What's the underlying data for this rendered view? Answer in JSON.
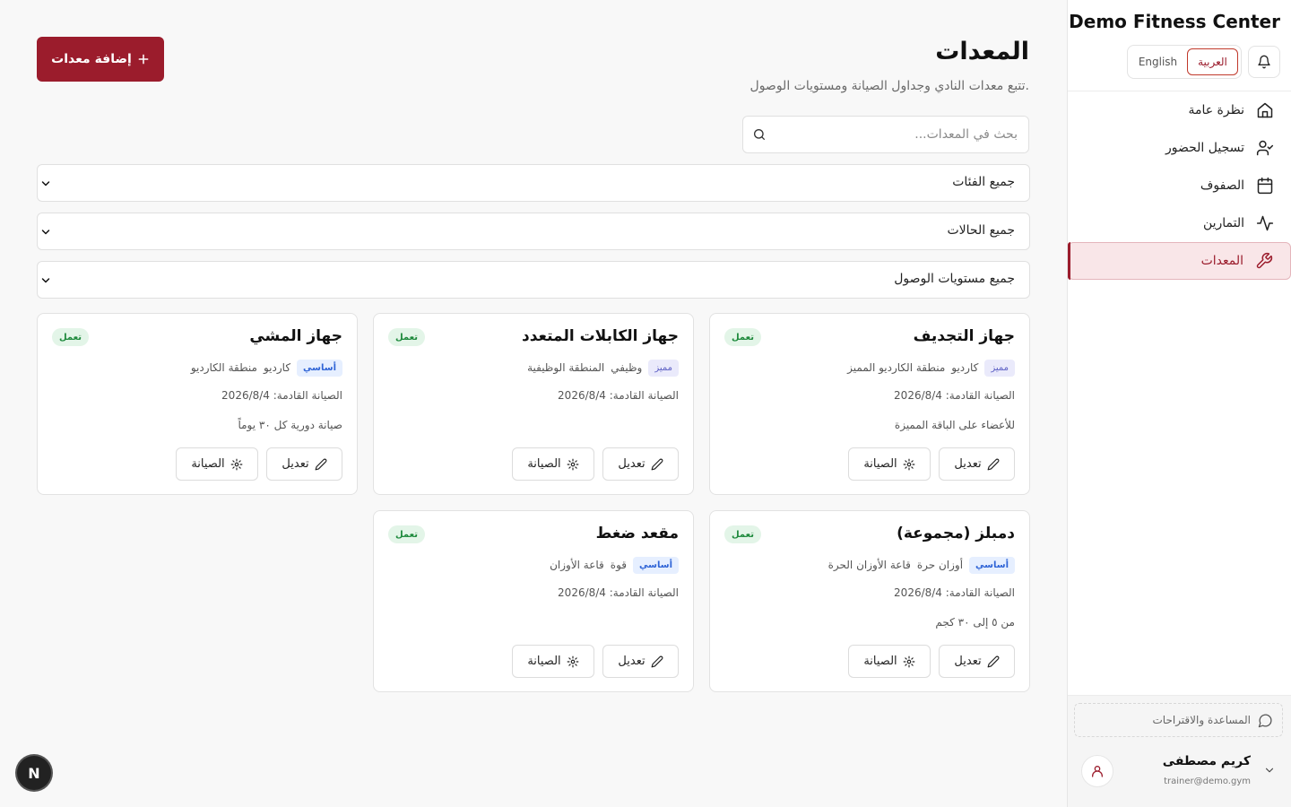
{
  "sidebar": {
    "brand": "Demo Fitness Center",
    "lang": {
      "arabic": "العربية",
      "english": "English"
    },
    "nav": [
      {
        "label": "نظرة عامة",
        "icon": "home-icon"
      },
      {
        "label": "تسجيل الحضور",
        "icon": "user-check-icon"
      },
      {
        "label": "الصفوف",
        "icon": "calendar-icon"
      },
      {
        "label": "التمارين",
        "icon": "activity-icon"
      },
      {
        "label": "المعدات",
        "icon": "wrench-icon",
        "active": true
      }
    ],
    "help": "المساعدة والاقتراحات",
    "user": {
      "name": "كريم مصطفى",
      "email": "trainer@demo.gym"
    }
  },
  "header": {
    "title": "المعدات",
    "subtitle": "تتبع معدات النادي وجداول الصيانة ومستويات الوصول.",
    "add_button": "إضافة معدات"
  },
  "search": {
    "placeholder": "بحث في المعدات..."
  },
  "filters": {
    "category": "جميع الفئات",
    "status": "جميع الحالات",
    "access": "جميع مستويات الوصول"
  },
  "cards": [
    {
      "title": "جهاز التجديف",
      "status": "تعمل",
      "tier": "مميز",
      "category": "كارديو",
      "area": "منطقة الكارديو المميز",
      "maintenance": "الصيانة القادمة: 2026/8/4",
      "note": "للأعضاء على الباقة المميزة",
      "edit": "تعديل",
      "maint_btn": "الصيانة"
    },
    {
      "title": "جهاز الكابلات المتعدد",
      "status": "تعمل",
      "tier": "مميز",
      "category": "وظيفي",
      "area": "المنطقة الوظيفية",
      "maintenance": "الصيانة القادمة: 2026/8/4",
      "note": "",
      "edit": "تعديل",
      "maint_btn": "الصيانة"
    },
    {
      "title": "جهاز المشي",
      "status": "تعمل",
      "tier": "أساسي",
      "category": "كارديو",
      "area": "منطقة الكارديو",
      "maintenance": "الصيانة القادمة: 2026/8/4",
      "note": "صيانة دورية كل ٣٠ يوماً",
      "edit": "تعديل",
      "maint_btn": "الصيانة"
    },
    {
      "title": "دمبلز (مجموعة)",
      "status": "تعمل",
      "tier": "أساسي",
      "category": "أوزان حرة",
      "area": "قاعة الأوزان الحرة",
      "maintenance": "الصيانة القادمة: 2026/8/4",
      "note": "من ٥ إلى ٣٠ كجم",
      "edit": "تعديل",
      "maint_btn": "الصيانة"
    },
    {
      "title": "مقعد ضغط",
      "status": "تعمل",
      "tier": "أساسي",
      "category": "قوة",
      "area": "قاعة الأوزان",
      "maintenance": "الصيانة القادمة: 2026/8/4",
      "note": "",
      "edit": "تعديل",
      "maint_btn": "الصيانة"
    }
  ],
  "dev_badge": "N",
  "colors": {
    "brand": "#9b1c2c",
    "active_bg": "#f9e6e8",
    "status_bg": "#e3f5e8",
    "status_text": "#1f8a3d"
  }
}
